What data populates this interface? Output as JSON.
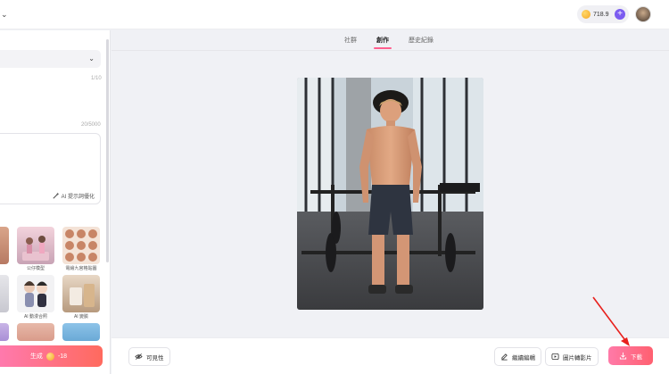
{
  "header": {
    "credits": "718.9",
    "plus_symbol": "+",
    "chevron": "⌄"
  },
  "left_panel": {
    "select_chevron": "⌄",
    "prompt_count": "1/10",
    "desc_count": "20/5000",
    "optimize_label": "AI 提示詞優化",
    "templates": [
      {
        "label": "公仔模型",
        "icon": "figurine-thumbnail"
      },
      {
        "label": "電繪九宮格貼圖",
        "icon": "sticker-grid-thumbnail"
      },
      {
        "label": "AI 動漫合照",
        "icon": "anime-photo-thumbnail"
      },
      {
        "label": "AI 變臉",
        "icon": "face-swap-thumbnail"
      }
    ],
    "generate_label": "生成",
    "generate_cost": "-18"
  },
  "tabs": [
    {
      "label": "社群",
      "active": false
    },
    {
      "label": "創作",
      "active": true
    },
    {
      "label": "歷史紀錄",
      "active": false
    }
  ],
  "toolbar": {
    "visibility_label": "可見性",
    "continue_edit_label": "繼續編輯",
    "image_to_video_label": "圖片轉影片",
    "download_label": "下載"
  },
  "colors": {
    "accent_pink": "#ff5f8f",
    "credit_purple": "#7b5cf0",
    "annotation_red": "#e8201c"
  }
}
